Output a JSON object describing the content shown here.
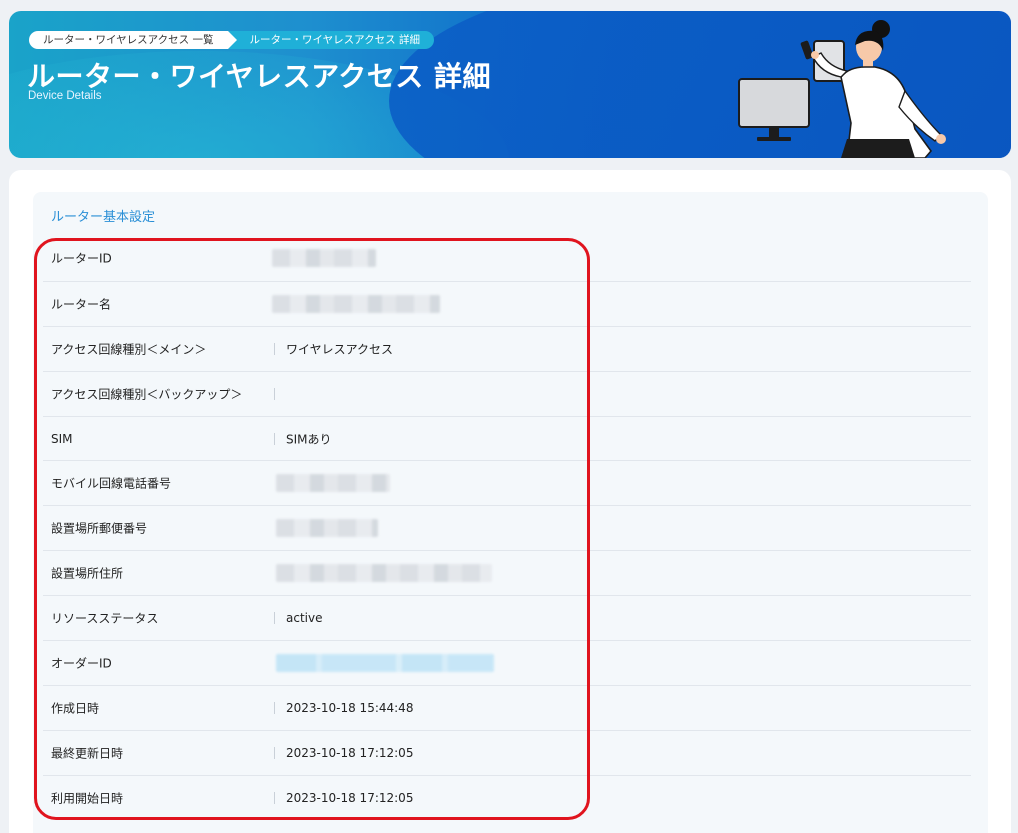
{
  "breadcrumb": {
    "parent": "ルーター・ワイヤレスアクセス 一覧",
    "current": "ルーター・ワイヤレスアクセス 詳細"
  },
  "header": {
    "title": "ルーター・ワイヤレスアクセス 詳細",
    "subtitle": "Device Details"
  },
  "section": {
    "title": "ルーター基本設定"
  },
  "fields": [
    {
      "label": "ルーターID",
      "value": ""
    },
    {
      "label": "ルーター名",
      "value": ""
    },
    {
      "label": "アクセス回線種別＜メイン＞",
      "value": "ワイヤレスアクセス"
    },
    {
      "label": "アクセス回線種別＜バックアップ＞",
      "value": ""
    },
    {
      "label": "SIM",
      "value": "SIMあり"
    },
    {
      "label": "モバイル回線電話番号",
      "value": ""
    },
    {
      "label": "設置場所郵便番号",
      "value": ""
    },
    {
      "label": "設置場所住所",
      "value": ""
    },
    {
      "label": "リソースステータス",
      "value": "active"
    },
    {
      "label": "オーダーID",
      "value": ""
    },
    {
      "label": "作成日時",
      "value": "2023-10-18 15:44:48"
    },
    {
      "label": "最終更新日時",
      "value": "2023-10-18 17:12:05"
    },
    {
      "label": "利用開始日時",
      "value": "2023-10-18 17:12:05"
    }
  ],
  "colors": {
    "accent": "#2a8fd6",
    "banner_start": "#1aa3c9",
    "banner_end": "#0a58c4",
    "highlight": "#e0141e"
  }
}
